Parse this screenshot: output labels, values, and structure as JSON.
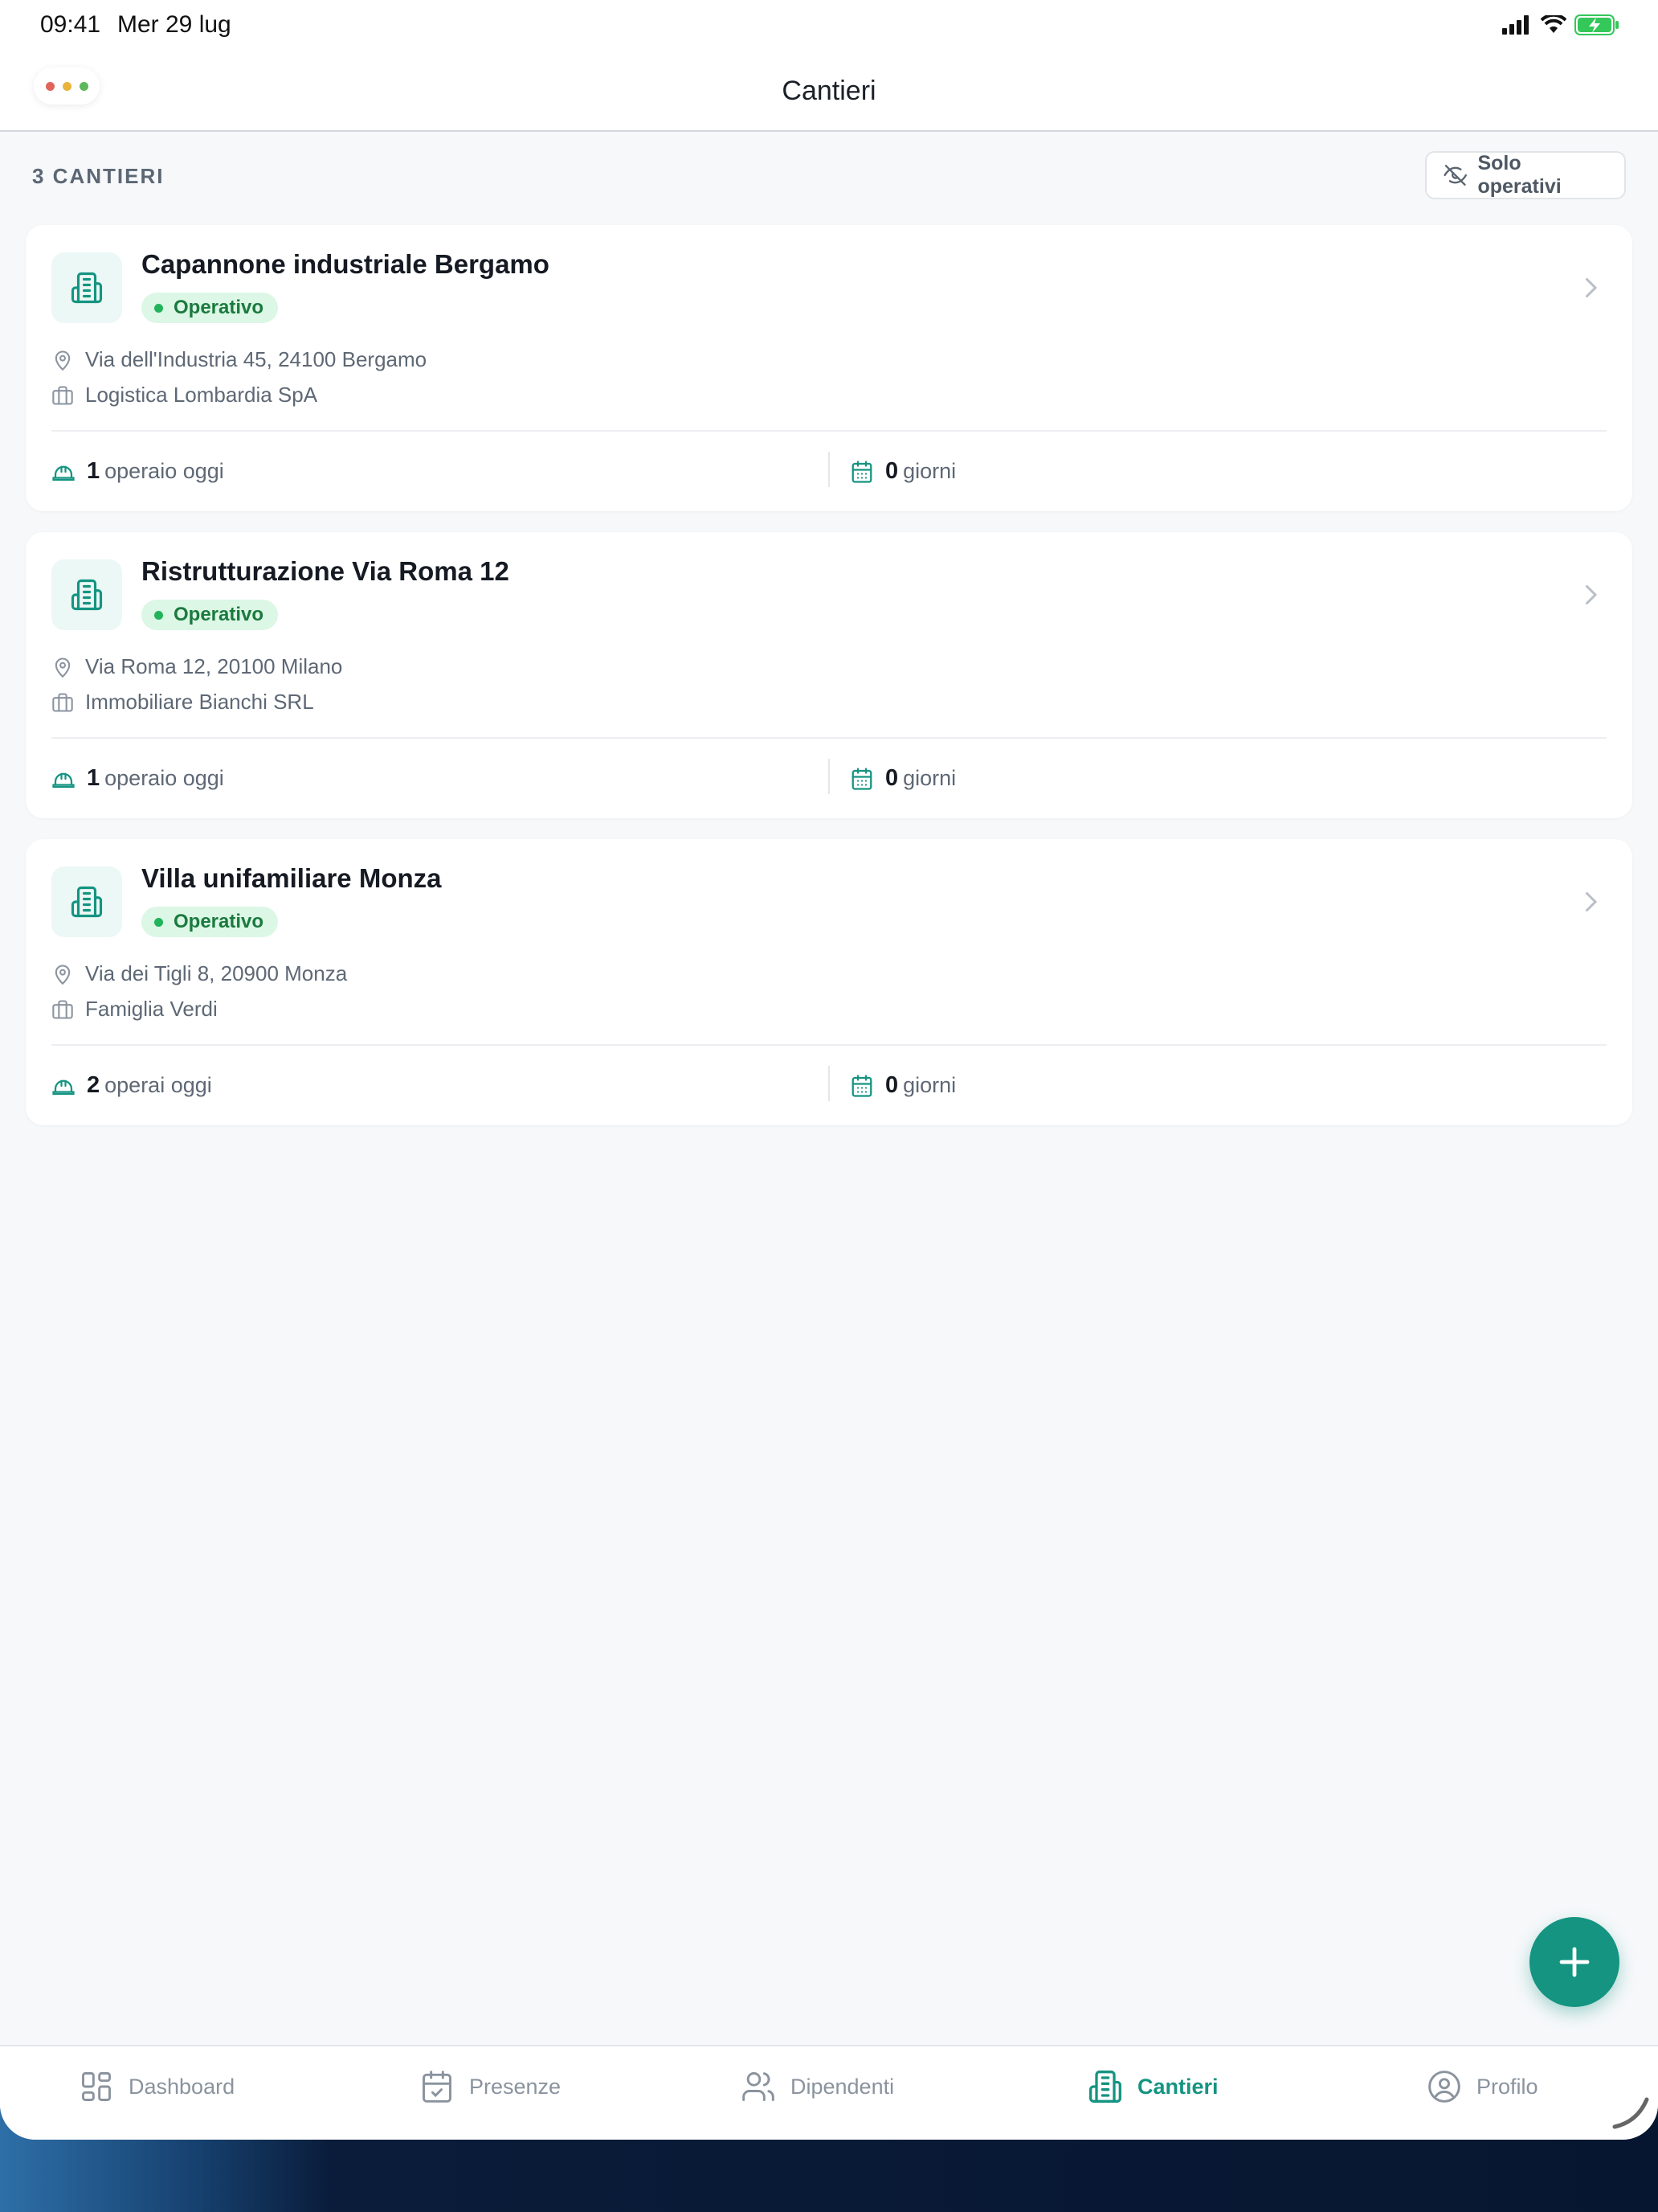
{
  "status_bar": {
    "time": "09:41",
    "date": "Mer 29 lug"
  },
  "header": {
    "title": "Cantieri"
  },
  "list": {
    "count_label": "3 CANTIERI",
    "filter_label": "Solo operativi"
  },
  "sites": [
    {
      "name": "Capannone industriale Bergamo",
      "status": "Operativo",
      "address": "Via dell'Industria 45, 24100 Bergamo",
      "client": "Logistica Lombardia SpA",
      "workers_count": "1",
      "workers_label": "operaio oggi",
      "days_count": "0",
      "days_label": "giorni"
    },
    {
      "name": "Ristrutturazione Via Roma 12",
      "status": "Operativo",
      "address": "Via Roma 12, 20100 Milano",
      "client": "Immobiliare Bianchi SRL",
      "workers_count": "1",
      "workers_label": "operaio oggi",
      "days_count": "0",
      "days_label": "giorni"
    },
    {
      "name": "Villa unifamiliare Monza",
      "status": "Operativo",
      "address": "Via dei Tigli 8, 20900 Monza",
      "client": "Famiglia Verdi",
      "workers_count": "2",
      "workers_label": "operai oggi",
      "days_count": "0",
      "days_label": "giorni"
    }
  ],
  "tabs": [
    {
      "label": "Dashboard",
      "icon": "dashboard-icon"
    },
    {
      "label": "Presenze",
      "icon": "calendar-check-icon"
    },
    {
      "label": "Dipendenti",
      "icon": "users-icon"
    },
    {
      "label": "Cantieri",
      "icon": "building-icon",
      "active": true
    },
    {
      "label": "Profilo",
      "icon": "user-circle-icon"
    }
  ],
  "colors": {
    "accent": "#149481",
    "status_green": "#22b35b",
    "badge_bg": "#dcf7e6",
    "background": "#f6f8fa"
  }
}
